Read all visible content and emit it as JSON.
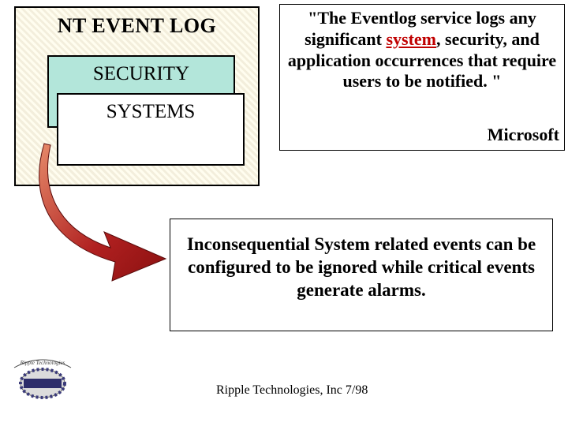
{
  "nt_event_log": {
    "title": "NT EVENT LOG",
    "cards": {
      "security": "SECURITY",
      "systems": "SYSTEMS"
    }
  },
  "quote": {
    "lead": "\"The Eventlog service logs any significant ",
    "highlight": "system",
    "tail": ", security, and application occurrences that require users to be notified. \"",
    "attribution": "Microsoft"
  },
  "callout": {
    "text": "Inconsequential System related events can be configured to be ignored while critical events generate alarms."
  },
  "footer": {
    "text": "Ripple Technologies, Inc 7/98"
  },
  "icons": {
    "arrow": "curved-arrow-icon",
    "logo": "ripple-logo-icon"
  }
}
